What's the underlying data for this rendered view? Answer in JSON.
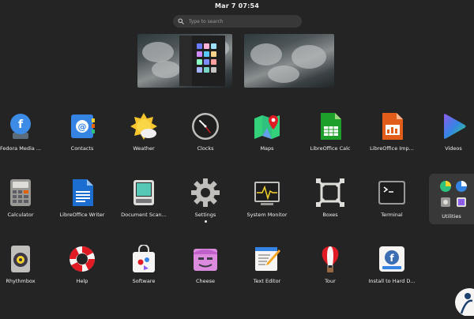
{
  "topbar": {
    "clock": "Mar 7  07:54"
  },
  "search": {
    "placeholder": "Type to search"
  },
  "apps": [
    {
      "id": "fedora-media-writer",
      "label": "Fedora Media ...",
      "icon": "fedora-media-writer-icon"
    },
    {
      "id": "contacts",
      "label": "Contacts",
      "icon": "contacts-icon"
    },
    {
      "id": "weather",
      "label": "Weather",
      "icon": "weather-icon"
    },
    {
      "id": "clocks",
      "label": "Clocks",
      "icon": "clock-icon"
    },
    {
      "id": "maps",
      "label": "Maps",
      "icon": "maps-icon"
    },
    {
      "id": "libreoffice-calc",
      "label": "LibreOffice Calc",
      "icon": "libreoffice-calc-icon"
    },
    {
      "id": "libreoffice-impress",
      "label": "LibreOffice Imp...",
      "icon": "libreoffice-impress-icon"
    },
    {
      "id": "videos",
      "label": "Videos",
      "icon": "videos-icon"
    },
    {
      "id": "calculator",
      "label": "Calculator",
      "icon": "calculator-icon"
    },
    {
      "id": "libreoffice-writer",
      "label": "LibreOffice Writer",
      "icon": "libreoffice-writer-icon"
    },
    {
      "id": "document-scanner",
      "label": "Document Scan...",
      "icon": "document-scanner-icon"
    },
    {
      "id": "settings",
      "label": "Settings",
      "icon": "gear-icon",
      "running": true
    },
    {
      "id": "system-monitor",
      "label": "System Monitor",
      "icon": "system-monitor-icon"
    },
    {
      "id": "boxes",
      "label": "Boxes",
      "icon": "boxes-icon"
    },
    {
      "id": "terminal",
      "label": "Terminal",
      "icon": "terminal-icon"
    },
    {
      "id": "utilities",
      "label": "Utilities",
      "icon": "folder-icon"
    },
    {
      "id": "rhythmbox",
      "label": "Rhythmbox",
      "icon": "speaker-icon"
    },
    {
      "id": "help",
      "label": "Help",
      "icon": "lifebuoy-icon"
    },
    {
      "id": "software",
      "label": "Software",
      "icon": "software-bag-icon"
    },
    {
      "id": "cheese",
      "label": "Cheese",
      "icon": "cheese-icon"
    },
    {
      "id": "text-editor",
      "label": "Text Editor",
      "icon": "text-editor-icon"
    },
    {
      "id": "tour",
      "label": "Tour",
      "icon": "hot-air-balloon-icon"
    },
    {
      "id": "install-to-hard-drive",
      "label": "Install to Hard D...",
      "icon": "install-icon"
    }
  ],
  "colors": {
    "background": "#242424",
    "search_bg": "#383838",
    "folder_bg": "#383838"
  }
}
